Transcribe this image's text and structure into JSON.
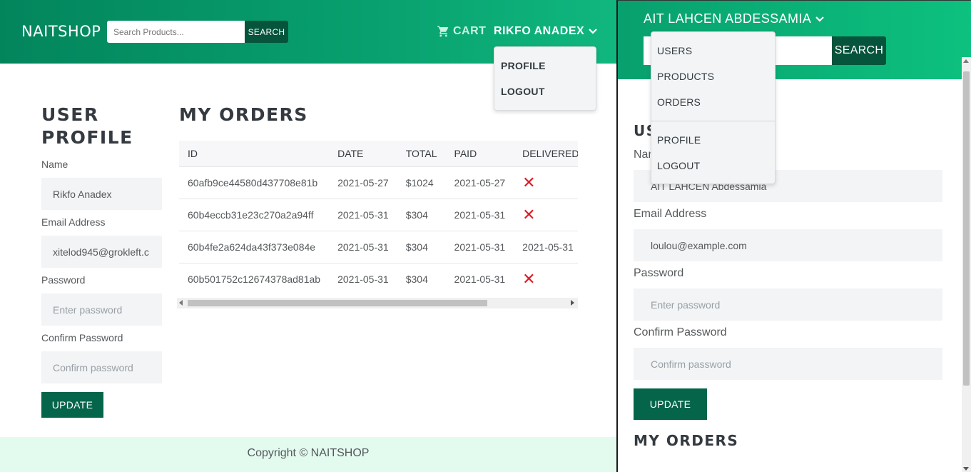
{
  "left": {
    "header": {
      "brand": "NAITSHOP",
      "search_placeholder": "Search Products...",
      "search_button": "SEARCH",
      "cart_label": "CART",
      "user_name": "RIKFO ANADEX",
      "dropdown": [
        "PROFILE",
        "LOGOUT"
      ]
    },
    "profile": {
      "title_line1": "USER",
      "title_line2": "PROFILE",
      "name_label": "Name",
      "name_value": "Rikfo Anadex",
      "email_label": "Email Address",
      "email_value": "xitelod945@grokleft.c",
      "password_label": "Password",
      "password_placeholder": "Enter password",
      "confirm_label": "Confirm Password",
      "confirm_placeholder": "Confirm password",
      "update_button": "UPDATE"
    },
    "orders": {
      "title": "MY ORDERS",
      "columns": [
        "ID",
        "DATE",
        "TOTAL",
        "PAID",
        "DELIVERED"
      ],
      "rows": [
        {
          "id": "60afb9ce44580d437708e81b",
          "date": "2021-05-27",
          "total": "$1024",
          "paid": "2021-05-27",
          "delivered": "x"
        },
        {
          "id": "60b4eccb31e23c270a2a94ff",
          "date": "2021-05-31",
          "total": "$304",
          "paid": "2021-05-31",
          "delivered": "x"
        },
        {
          "id": "60b4fe2a624da43f373e084e",
          "date": "2021-05-31",
          "total": "$304",
          "paid": "2021-05-31",
          "delivered": "2021-05-31"
        },
        {
          "id": "60b501752c12674378ad81ab",
          "date": "2021-05-31",
          "total": "$304",
          "paid": "2021-05-31",
          "delivered": "x"
        }
      ]
    },
    "footer": "Copyright © NAITSHOP"
  },
  "right": {
    "header": {
      "user_name": "AIT LAHCEN ABDESSAMIA",
      "search_button": "SEARCH"
    },
    "dropdown": {
      "admin_items": [
        "USERS",
        "PRODUCTS",
        "ORDERS"
      ],
      "user_items": [
        "PROFILE",
        "LOGOUT"
      ]
    },
    "profile": {
      "title_partial": "USE",
      "name_label_partial": "Nam",
      "name_value": "AIT LAHCEN Abdessamia",
      "email_label": "Email Address",
      "email_value": "loulou@example.com",
      "password_label": "Password",
      "password_placeholder": "Enter password",
      "confirm_label": "Confirm Password",
      "confirm_placeholder": "Confirm password",
      "update_button": "UPDATE"
    },
    "orders_title": "MY ORDERS"
  },
  "colors": {
    "header_green": "#03855c",
    "header_green_light": "#10b77f",
    "button_dark_green": "#05654a",
    "search_button": "#05543b",
    "delivered_no": "#e01b24",
    "footer_bg": "#e3fbef"
  },
  "icons": [
    "cart-icon",
    "chevron-down-icon",
    "x-mark-icon"
  ]
}
